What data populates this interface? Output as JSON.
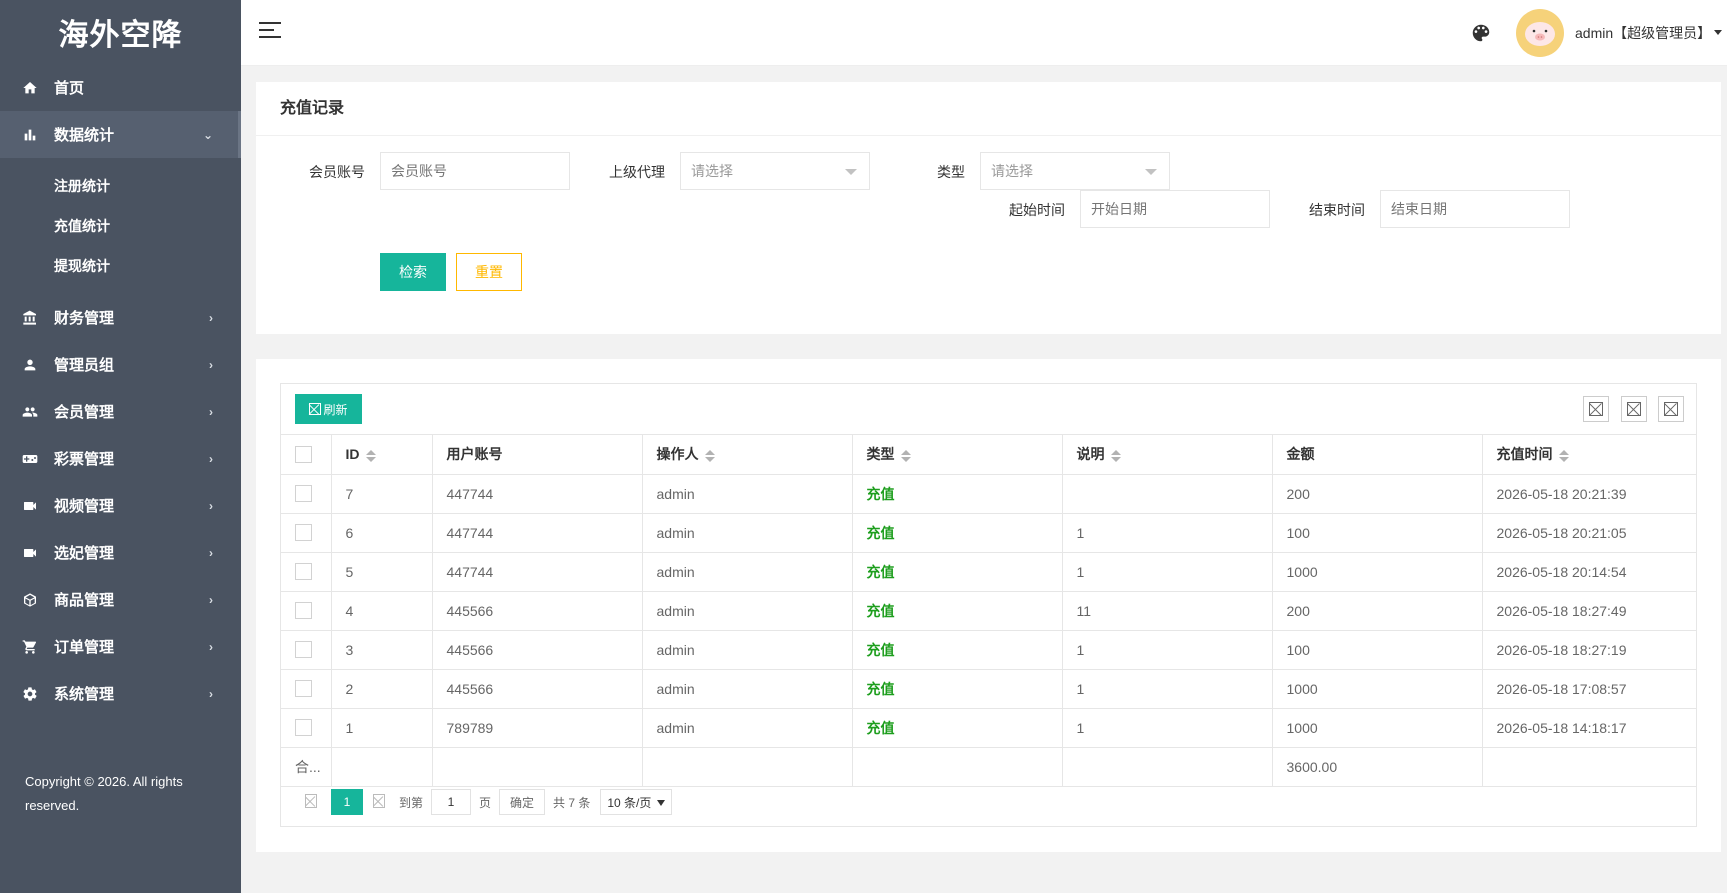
{
  "brand": "海外空降",
  "sidebar": {
    "items": [
      {
        "label": "首页",
        "icon": "home-icon"
      },
      {
        "label": "数据统计",
        "icon": "bar-chart-icon",
        "expanded": true,
        "children": [
          "注册统计",
          "充值统计",
          "提现统计"
        ]
      },
      {
        "label": "财务管理",
        "icon": "bank-icon"
      },
      {
        "label": "管理员组",
        "icon": "person-icon"
      },
      {
        "label": "会员管理",
        "icon": "group-icon"
      },
      {
        "label": "彩票管理",
        "icon": "gamepad-icon"
      },
      {
        "label": "视频管理",
        "icon": "video-icon"
      },
      {
        "label": "选妃管理",
        "icon": "video-icon"
      },
      {
        "label": "商品管理",
        "icon": "package-icon"
      },
      {
        "label": "订单管理",
        "icon": "cart-icon"
      },
      {
        "label": "系统管理",
        "icon": "gear-icon"
      }
    ],
    "copyright": "Copyright © 2026. All rights reserved."
  },
  "header": {
    "user": "admin【超级管理员】"
  },
  "search": {
    "title": "充值记录",
    "member_label": "会员账号",
    "member_placeholder": "会员账号",
    "agent_label": "上级代理",
    "agent_value": "请选择",
    "type_label": "类型",
    "type_value": "请选择",
    "start_label": "起始时间",
    "start_placeholder": "开始日期",
    "end_label": "结束时间",
    "end_placeholder": "结束日期",
    "search_button": "检索",
    "reset_button": "重置"
  },
  "table": {
    "refresh_label": "刷新",
    "columns": [
      "ID",
      "用户账号",
      "操作人",
      "类型",
      "说明",
      "金额",
      "充值时间"
    ],
    "rows": [
      {
        "id": "7",
        "account": "447744",
        "operator": "admin",
        "type": "充值",
        "note": "",
        "amount": "200",
        "time": "2026-05-18 20:21:39"
      },
      {
        "id": "6",
        "account": "447744",
        "operator": "admin",
        "type": "充值",
        "note": "1",
        "amount": "100",
        "time": "2026-05-18 20:21:05"
      },
      {
        "id": "5",
        "account": "447744",
        "operator": "admin",
        "type": "充值",
        "note": "1",
        "amount": "1000",
        "time": "2026-05-18 20:14:54"
      },
      {
        "id": "4",
        "account": "445566",
        "operator": "admin",
        "type": "充值",
        "note": "11",
        "amount": "200",
        "time": "2026-05-18 18:27:49"
      },
      {
        "id": "3",
        "account": "445566",
        "operator": "admin",
        "type": "充值",
        "note": "1",
        "amount": "100",
        "time": "2026-05-18 18:27:19"
      },
      {
        "id": "2",
        "account": "445566",
        "operator": "admin",
        "type": "充值",
        "note": "1",
        "amount": "1000",
        "time": "2026-05-18 17:08:57"
      },
      {
        "id": "1",
        "account": "789789",
        "operator": "admin",
        "type": "充值",
        "note": "1",
        "amount": "1000",
        "time": "2026-05-18 14:18:17"
      }
    ],
    "total_label": "合...",
    "total_amount": "3600.00"
  },
  "pager": {
    "current": "1",
    "goto_label": "到第",
    "page_input": "1",
    "page_unit": "页",
    "confirm": "确定",
    "total": "共 7 条",
    "page_size": "10 条/页"
  },
  "colors": {
    "sidebar": "#4a5361",
    "accent": "#16b59b",
    "reset": "#ffb800",
    "type_text": "#1e9e1e"
  }
}
